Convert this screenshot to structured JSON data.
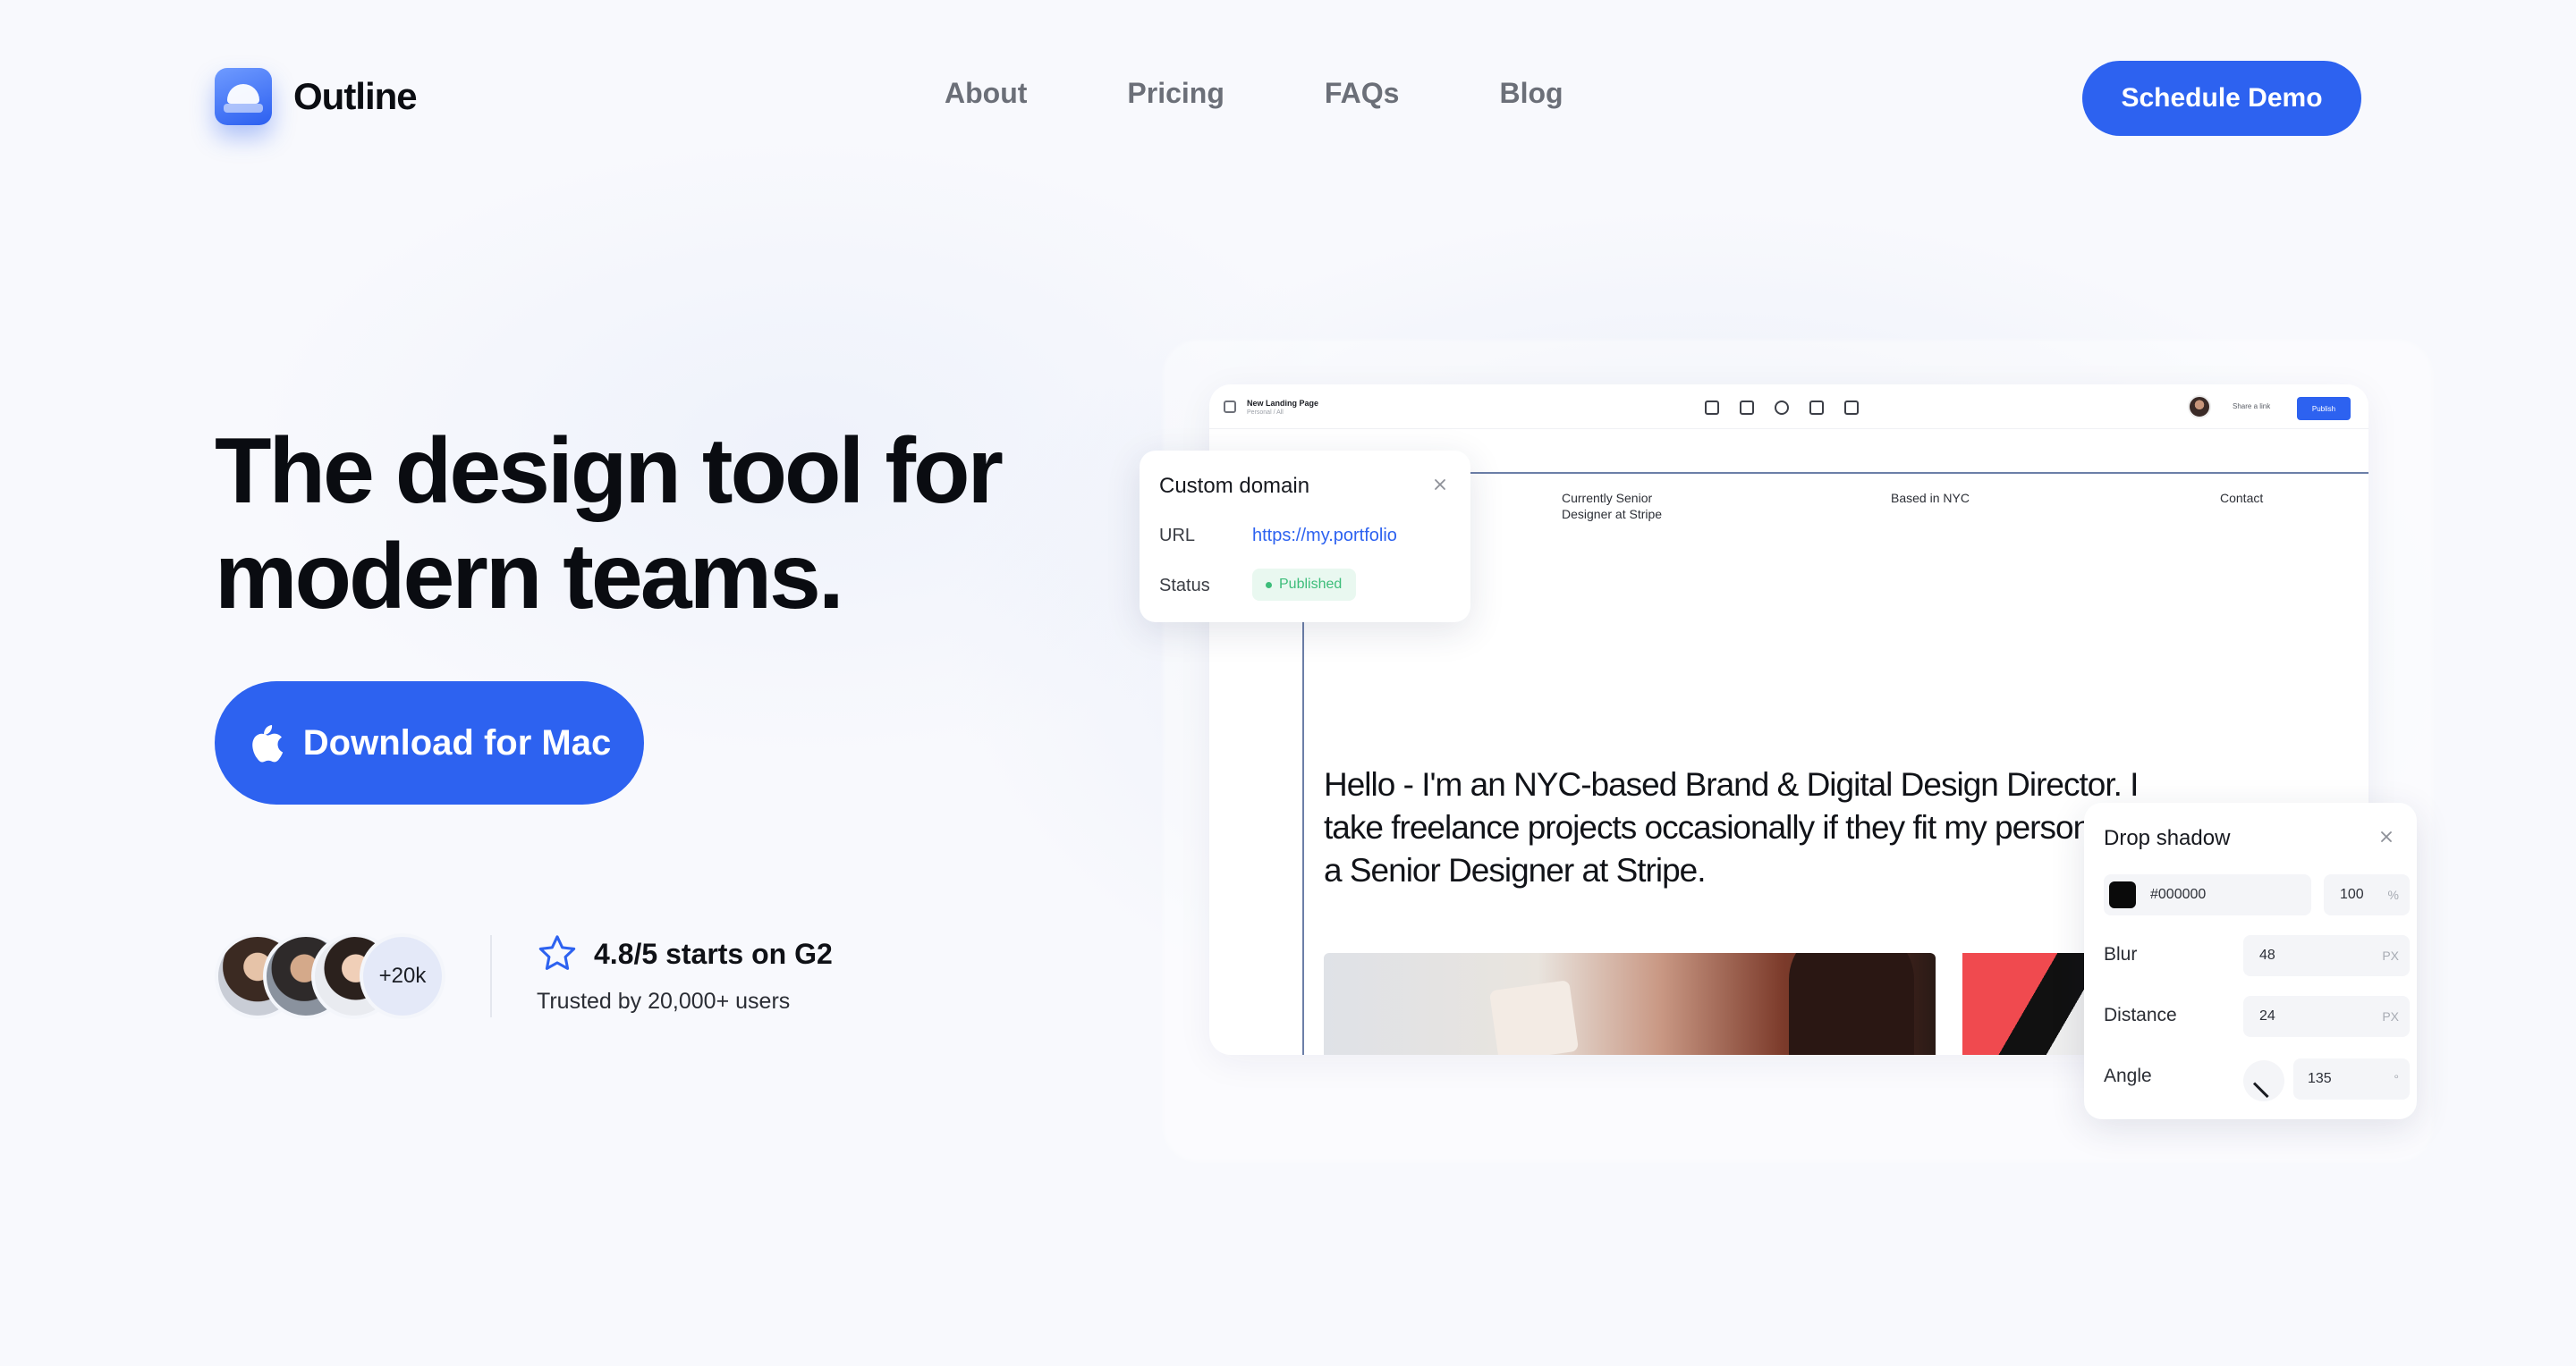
{
  "brand": {
    "name": "Outline",
    "accent": "#2d62f0"
  },
  "nav": {
    "links": [
      "About",
      "Pricing",
      "FAQs",
      "Blog"
    ],
    "cta": "Schedule Demo"
  },
  "hero": {
    "title_line1": "The design tool for",
    "title_line2": "modern teams.",
    "download_label": "Download for Mac",
    "download_icon": "apple-icon"
  },
  "social_proof": {
    "more_users": "+20k",
    "rating": "4.8/5 starts on G2",
    "trusted": "Trusted by 20,000+ users"
  },
  "app": {
    "doc_title": "New Landing Page",
    "doc_sub": "Personal / All",
    "share_label": "Share a link",
    "publish_label": "Publish",
    "site": {
      "col1": "Currently Senior Designer at Stripe",
      "col2": "Based in NYC",
      "col3": "Contact",
      "intro": "Hello - I'm an NYC-based Brand & Digital Design Director. I take freelance projects occasionally if they fit my personal valu a Senior Designer at Stripe."
    }
  },
  "custom_domain": {
    "title": "Custom domain",
    "url_label": "URL",
    "url_value": "https://my.portfolio",
    "status_label": "Status",
    "status_value": "Published"
  },
  "drop_shadow": {
    "title": "Drop shadow",
    "color_hex": "#000000",
    "opacity": "100",
    "opacity_unit": "%",
    "blur_label": "Blur",
    "blur_value": "48",
    "distance_label": "Distance",
    "distance_value": "24",
    "px_unit": "PX",
    "angle_label": "Angle",
    "angle_value": "135",
    "angle_unit": "°"
  }
}
